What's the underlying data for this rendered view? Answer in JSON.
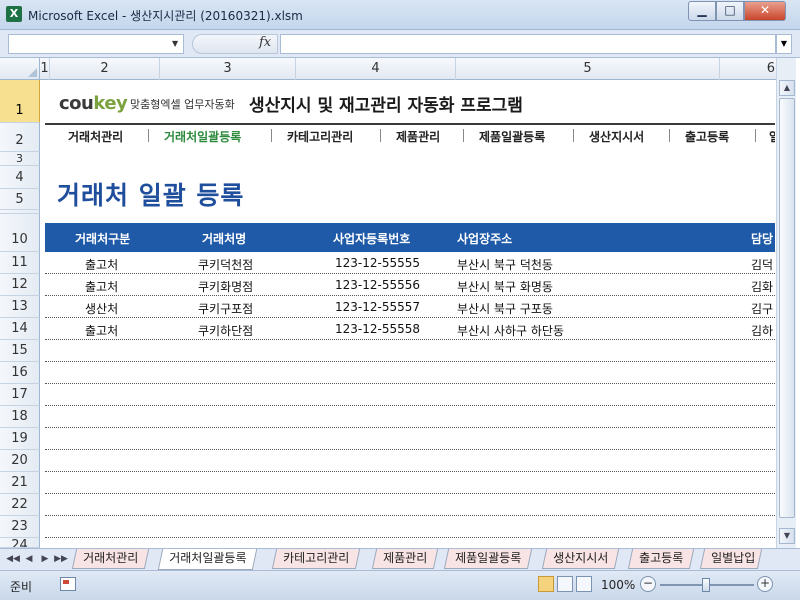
{
  "window": {
    "title": "Microsoft Excel - 생산지시관리 (20160321).xlsm",
    "app_icon": "X",
    "min_glyph": "▁",
    "max_glyph": "□",
    "close_glyph": "✕"
  },
  "formula_bar": {
    "name_box_value": "",
    "fx": "fx",
    "formula_value": ""
  },
  "columns": [
    "1",
    "2",
    "3",
    "4",
    "5",
    "6"
  ],
  "rows": [
    "1",
    "2",
    "3",
    "4",
    "5",
    "10",
    "11",
    "12",
    "13",
    "14",
    "15",
    "16",
    "17",
    "18",
    "19",
    "20",
    "21",
    "22",
    "23",
    "24"
  ],
  "header": {
    "logo_part1": "cou",
    "logo_part2": "key",
    "logo_sub": "맞춤형엑셀 업무자동화",
    "program_title": "생산지시 및 재고관리 자동화 프로그램"
  },
  "nav": {
    "items": [
      "거래처관리",
      "거래처일괄등록",
      "카테고리관리",
      "제품관리",
      "제품일괄등록",
      "생산지시서",
      "출고등록",
      "일"
    ],
    "active": "거래처일괄등록"
  },
  "page_title": "거래처 일괄 등록",
  "table": {
    "headers": [
      "거래처구분",
      "거래처명",
      "사업자등록번호",
      "사업장주소",
      "담당"
    ],
    "rows": [
      [
        "출고처",
        "쿠키덕천점",
        "123-12-55555",
        "부산시 북구 덕천동",
        "김덕"
      ],
      [
        "출고처",
        "쿠키화명점",
        "123-12-55556",
        "부산시 북구 화명동",
        "김화"
      ],
      [
        "생산처",
        "쿠키구포점",
        "123-12-55557",
        "부산시 북구 구포동",
        "김구"
      ],
      [
        "출고처",
        "쿠키하단점",
        "123-12-55558",
        "부산시 사하구 하단동",
        "김하"
      ]
    ]
  },
  "sheet_tabs": {
    "items": [
      "거래처관리",
      "거래처일괄등록",
      "카테고리관리",
      "제품관리",
      "제품일괄등록",
      "생산지시서",
      "출고등록",
      "일별납입"
    ],
    "active": "거래처일괄등록",
    "nav_first": "◀◀",
    "nav_prev": "◀",
    "nav_next": "▶",
    "nav_last": "▶▶"
  },
  "status": {
    "ready": "준비",
    "zoom": "100%",
    "zoom_out": "−",
    "zoom_in": "+"
  },
  "scroll": {
    "up": "▲",
    "down": "▼"
  },
  "colors": {
    "table_header": "#1f5aa8",
    "title": "#1f4e9c",
    "active_nav": "#2e8b3e",
    "logo_accent": "#7ba23f"
  }
}
